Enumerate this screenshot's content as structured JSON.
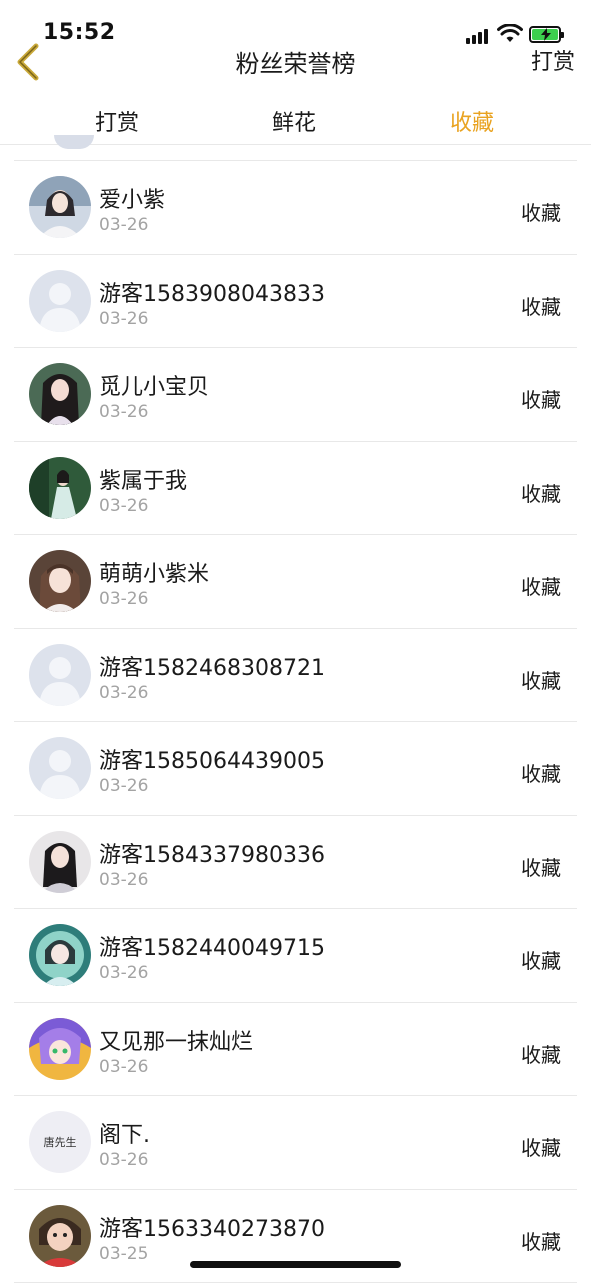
{
  "status_bar": {
    "time": "15:52"
  },
  "nav": {
    "title": "粉丝荣誉榜",
    "right_action": "打赏"
  },
  "tabs": [
    {
      "label": "打赏",
      "active": false
    },
    {
      "label": "鲜花",
      "active": false
    },
    {
      "label": "收藏",
      "active": true
    }
  ],
  "accent_color": "#e9a321",
  "rows": [
    {
      "name": "爱小紫",
      "date": "03-26",
      "action": "收藏",
      "avatar": "photo"
    },
    {
      "name": "游客1583908043833",
      "date": "03-26",
      "action": "收藏",
      "avatar": "default-user"
    },
    {
      "name": "觅儿小宝贝",
      "date": "03-26",
      "action": "收藏",
      "avatar": "photo"
    },
    {
      "name": "紫属于我",
      "date": "03-26",
      "action": "收藏",
      "avatar": "photo"
    },
    {
      "name": "萌萌小紫米",
      "date": "03-26",
      "action": "收藏",
      "avatar": "photo"
    },
    {
      "name": "游客1582468308721",
      "date": "03-26",
      "action": "收藏",
      "avatar": "default-user"
    },
    {
      "name": "游客1585064439005",
      "date": "03-26",
      "action": "收藏",
      "avatar": "default-user"
    },
    {
      "name": "游客1584337980336",
      "date": "03-26",
      "action": "收藏",
      "avatar": "photo"
    },
    {
      "name": "游客1582440049715",
      "date": "03-26",
      "action": "收藏",
      "avatar": "photo"
    },
    {
      "name": "又见那一抹灿烂",
      "date": "03-26",
      "action": "收藏",
      "avatar": "photo"
    },
    {
      "name": "阁下.",
      "date": "03-26",
      "action": "收藏",
      "avatar": "text",
      "avatar_text": "唐先生"
    },
    {
      "name": "游客1563340273870",
      "date": "03-25",
      "action": "收藏",
      "avatar": "photo"
    }
  ]
}
